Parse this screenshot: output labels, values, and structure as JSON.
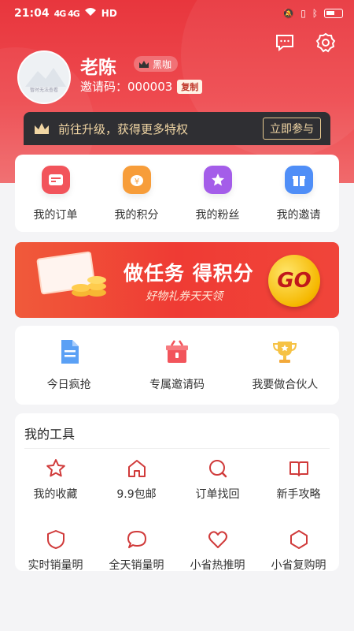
{
  "status_bar": {
    "time": "21:04",
    "signal": "4G 4G",
    "network": "HD"
  },
  "header": {
    "message_icon": "chat-icon",
    "settings_icon": "gear-icon"
  },
  "profile": {
    "name": "老陈",
    "level": "黑咖",
    "invite_label": "邀请码：",
    "invite_code": "000003",
    "copy_label": "复制",
    "avatar_caption": "暂时无法查看"
  },
  "upgrade": {
    "text": "前往升级，获得更多特权",
    "button": "立即参与"
  },
  "quick_menu": [
    {
      "label": "我的订单",
      "icon": "order-icon",
      "color": "#f2545b"
    },
    {
      "label": "我的积分",
      "icon": "points-icon",
      "color": "#f79d3a"
    },
    {
      "label": "我的粉丝",
      "icon": "star-icon",
      "color": "#a45de9"
    },
    {
      "label": "我的邀请",
      "icon": "gift-icon",
      "color": "#4f8ef7"
    }
  ],
  "banner": {
    "title": "做任务 得积分",
    "subtitle": "好物礼券天天领",
    "coin_text": "GO"
  },
  "partner_menu": [
    {
      "label": "今日疯抢",
      "icon": "document-icon",
      "color": "#4f8ef7"
    },
    {
      "label": "专属邀请码",
      "icon": "gift-box-icon",
      "color": "#f2545b"
    },
    {
      "label": "我要做合伙人",
      "icon": "trophy-icon",
      "color": "#f6c244"
    }
  ],
  "tools": {
    "title": "我的工具",
    "items": [
      {
        "label": "我的收藏",
        "icon": "star-outline-icon"
      },
      {
        "label": "9.9包邮",
        "icon": "house-icon"
      },
      {
        "label": "订单找回",
        "icon": "search-icon"
      },
      {
        "label": "新手攻略",
        "icon": "book-icon"
      },
      {
        "label": "实时销量明",
        "icon": "shield-icon"
      },
      {
        "label": "全天销量明",
        "icon": "chat-bubble-icon"
      },
      {
        "label": "小省热推明",
        "icon": "heart-icon"
      },
      {
        "label": "小省复购明",
        "icon": "hexagon-icon"
      }
    ]
  },
  "colors": {
    "brand_red": "#e8363d",
    "tool_icon": "#d03a3a"
  }
}
